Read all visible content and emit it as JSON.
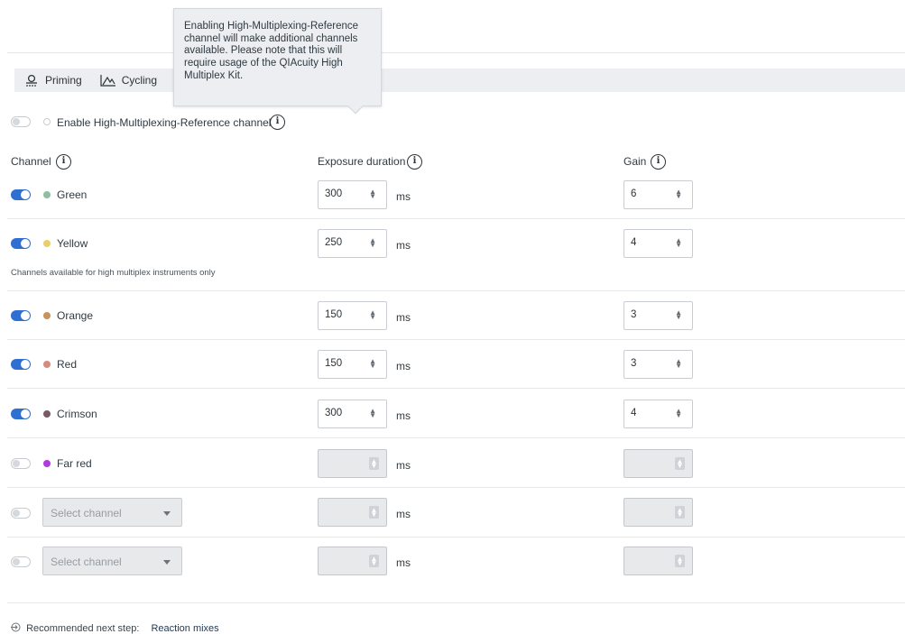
{
  "tabs": [
    {
      "label": "Priming",
      "icon": "priming-icon"
    },
    {
      "label": "Cycling",
      "icon": "cycling-icon"
    }
  ],
  "tooltip": {
    "text": "Enabling High-Multiplexing-Reference channel will make additional channels available. Please note that this will require usage of the QIAcuity High Multiplex Kit."
  },
  "hmr": {
    "label": "Enable High-Multiplexing-Reference channel",
    "enabled": false
  },
  "headers": {
    "channel": "Channel",
    "exposure": "Exposure duration",
    "gain": "Gain"
  },
  "unit": "ms",
  "note": "Channels available for high multiplex instruments only",
  "select_placeholder": "Select channel",
  "channels": [
    {
      "name": "Green",
      "color": "#8fbfa0",
      "enabled": true,
      "exposure": "300",
      "gain": "6"
    },
    {
      "name": "Yellow",
      "color": "#e8cf6a",
      "enabled": true,
      "exposure": "250",
      "gain": "4"
    },
    {
      "name": "Orange",
      "color": "#c9925a",
      "enabled": true,
      "exposure": "150",
      "gain": "3"
    },
    {
      "name": "Red",
      "color": "#d88a7e",
      "enabled": true,
      "exposure": "150",
      "gain": "3"
    },
    {
      "name": "Crimson",
      "color": "#7a5a62",
      "enabled": true,
      "exposure": "300",
      "gain": "4"
    },
    {
      "name": "Far red",
      "color": "#b23be0",
      "enabled": false,
      "exposure": "",
      "gain": ""
    }
  ],
  "next_step": {
    "prefix": "Recommended next step:",
    "link": "Reaction mixes",
    "icon": "next-step-icon"
  }
}
